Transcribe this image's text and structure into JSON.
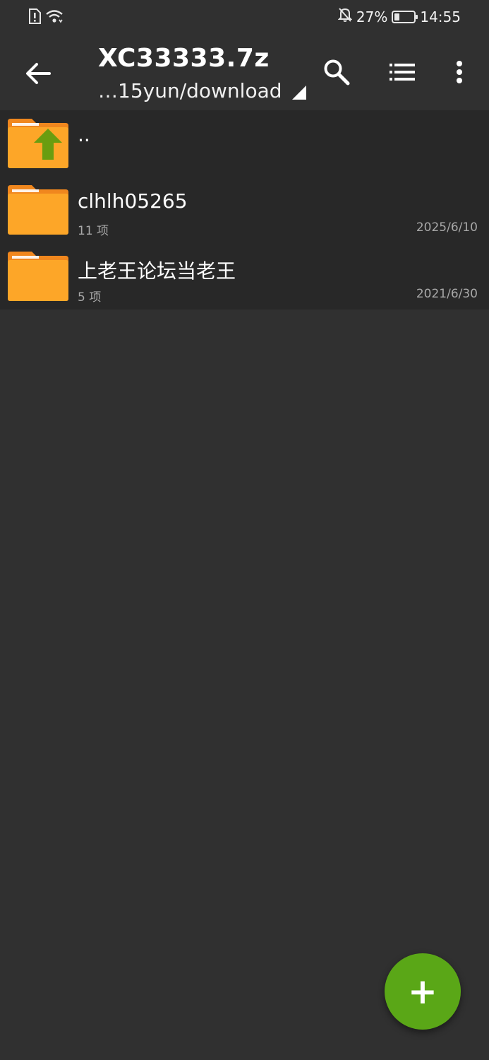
{
  "status_bar": {
    "battery_percent": "27%",
    "battery_level": 0.27,
    "time": "14:55",
    "icons": [
      "alert-sim-icon",
      "wifi-icon",
      "bell-off-icon",
      "battery-icon"
    ]
  },
  "app_bar": {
    "title": "XC33333.7z",
    "path": "…15yun/download",
    "icons": [
      "back-arrow-icon",
      "search-icon",
      "list-view-icon",
      "more-vert-icon"
    ]
  },
  "file_list": {
    "parent": {
      "name": ".."
    },
    "items": [
      {
        "name": "clhlh05265",
        "meta": "11 项",
        "date": "2025/6/10"
      },
      {
        "name": "上老王论坛当老王",
        "meta": "5 项",
        "date": "2021/6/30"
      }
    ]
  },
  "fab": {
    "label": "+"
  },
  "colors": {
    "background": "#303030",
    "list_background": "#282828",
    "folder_orange": "#fda628",
    "folder_tab": "#f0871e",
    "up_arrow_green": "#6a9d10",
    "fab_green": "#5aa717"
  }
}
